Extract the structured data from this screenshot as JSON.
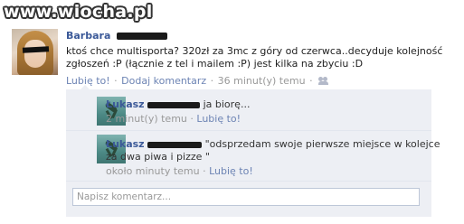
{
  "watermark": "www.wiocha.pl",
  "post": {
    "author": "Barbara",
    "text": "ktoś chce multisporta? 320zł za 3mc z góry od czerwca..decyduje kolejność zgłoszeń :P (łącznie z tel i mailem :P) jest kilka na zbyciu :D",
    "like_label": "Lubię to!",
    "comment_label": "Dodaj komentarz",
    "time": "36 minut(y) temu",
    "separator": "·"
  },
  "comments": [
    {
      "author": "Łukasz",
      "text": "ja biorę...",
      "time": "2 minut(y) temu",
      "like_label": "Lubię to!"
    },
    {
      "author": "Łukasz",
      "text_line1": "\"odsprzedam swoje pierwsze miejsce w kolejce",
      "text_line2": "za dwa piwa i pizze \"",
      "time": "około minuty temu",
      "like_label": "Lubię to!"
    }
  ],
  "comment_input": {
    "placeholder": "Napisz komentarz..."
  },
  "colors": {
    "link": "#3b5998",
    "meta_link": "#6d84b4",
    "comment_bg": "#edeff4"
  },
  "icons": {
    "audience": "people-icon"
  }
}
